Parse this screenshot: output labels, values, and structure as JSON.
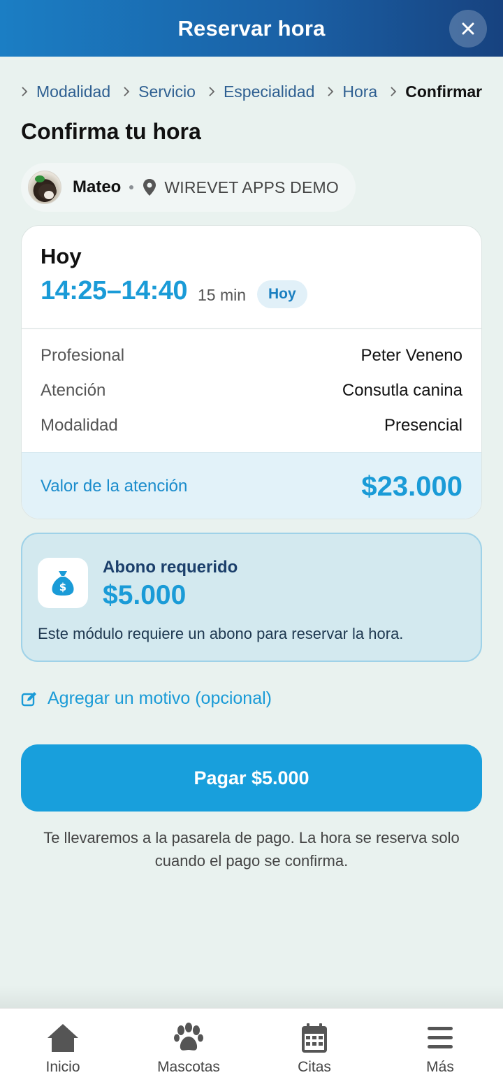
{
  "header": {
    "title": "Reservar hora",
    "close_icon": "close-icon"
  },
  "breadcrumb": {
    "items": [
      {
        "label": "Modalidad"
      },
      {
        "label": "Servicio"
      },
      {
        "label": "Especialidad"
      },
      {
        "label": "Hora"
      },
      {
        "label": "Confirmar",
        "current": true
      }
    ]
  },
  "page": {
    "title": "Confirma tu hora"
  },
  "pet": {
    "name": "Mateo",
    "clinic": "WIREVET APPS DEMO"
  },
  "appointment": {
    "day": "Hoy",
    "time": "14:25–14:40",
    "duration": "15 min",
    "badge": "Hoy",
    "details": [
      {
        "label": "Profesional",
        "value": "Peter Veneno"
      },
      {
        "label": "Atención",
        "value": "Consutla canina"
      },
      {
        "label": "Modalidad",
        "value": "Presencial"
      }
    ],
    "price_label": "Valor de la atención",
    "price_value": "$23.000"
  },
  "deposit": {
    "title": "Abono requerido",
    "amount": "$5.000",
    "note": "Este módulo requiere un abono para reservar la hora."
  },
  "reason_link": "Agregar un motivo (opcional)",
  "pay_button": "Pagar $5.000",
  "pay_note_line1": "Te llevaremos a la pasarela de pago. La hora se reserva solo",
  "pay_note_line2": "cuando el pago se confirma.",
  "nav": {
    "items": [
      {
        "label": "Inicio",
        "icon": "home-icon"
      },
      {
        "label": "Mascotas",
        "icon": "paw-icon"
      },
      {
        "label": "Citas",
        "icon": "calendar-icon"
      },
      {
        "label": "Más",
        "icon": "menu-icon"
      }
    ]
  },
  "colors": {
    "accent": "#1a9bd7",
    "header_start": "#1b7ec4",
    "header_end": "#17427f",
    "background": "#e9f2ef",
    "deposit_bg": "#d3e9ef"
  }
}
